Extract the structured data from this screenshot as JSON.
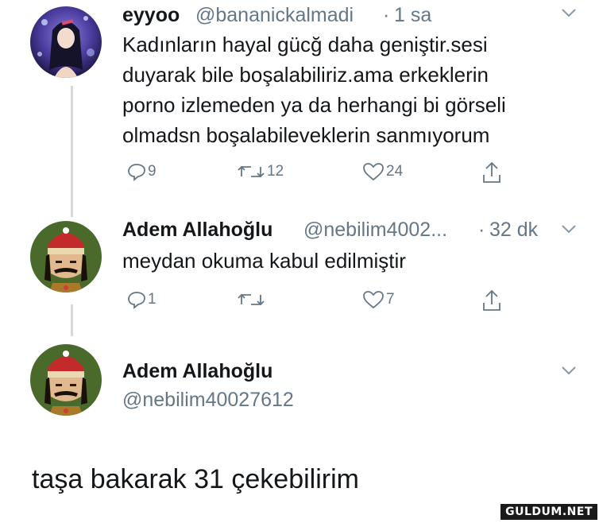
{
  "tweet1": {
    "display_name": "eyyoo",
    "handle": "@bananickalmadi",
    "separator": "·",
    "time": "1 sa",
    "body_lines": [
      "Kadınların hayal gücğ daha geniştir.sesi",
      "duyarak bile boşalabiliriz.ama erkeklerin",
      "porno izlemeden ya da herhangi bi görseli",
      "olmadsn boşalabileveklerin sanmıyorum"
    ],
    "reply_count": "9",
    "retweet_count": "12",
    "like_count": "24"
  },
  "tweet2": {
    "display_name": "Adem Allahoğlu",
    "handle": "@nebilim4002...",
    "separator": "·",
    "time": "32 dk",
    "body": "meydan okuma kabul edilmiştir",
    "reply_count": "1",
    "retweet_count": "",
    "like_count": "7"
  },
  "tweet3": {
    "display_name": "Adem Allahoğlu",
    "handle": "@nebilim40027612",
    "body": "taşa bakarak 31 çekebilirim"
  },
  "watermark": "GULDUM.NET",
  "colors": {
    "text_primary": "#14171a",
    "text_secondary": "#657786",
    "thread_line": "#d3d9de"
  },
  "icons": [
    "chevron-down-icon",
    "reply-icon",
    "retweet-icon",
    "like-icon",
    "share-icon"
  ]
}
